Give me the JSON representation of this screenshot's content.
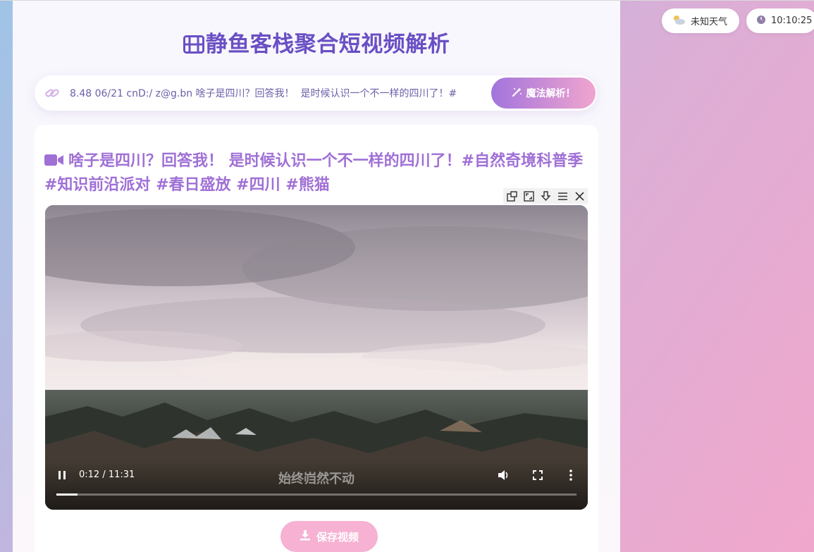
{
  "page": {
    "title": "静鱼客栈聚合短视频解析"
  },
  "search": {
    "value": "8.48 06/21 cnD:/ z@g.bn 啥子是四川？回答我！  是时候认识一个不一样的四川了！#",
    "parse_label": "魔法解析！"
  },
  "video": {
    "title": "啥子是四川？回答我！  是时候认识一个不一样的四川了！#自然奇境科普季 #知识前沿派对 #春日盛放 #四川 #熊猫",
    "time": "0:12 / 11:31",
    "subtitle": "始终岿然不动",
    "progress": 0.0174
  },
  "save": {
    "label": "保存视频"
  },
  "status": {
    "weather": "未知天气",
    "clock": "10:10:25"
  },
  "colors": {
    "title": "#6a4fc4",
    "video_title": "#a070d6",
    "accent_start": "#a274dc",
    "accent_end": "#f0a5cf",
    "save_button": "#f6b1d3"
  },
  "icons": {
    "title": "film-icon",
    "search": "link-icon",
    "parse": "magic-wand-icon",
    "video_title": "video-camera-icon",
    "toolbar": [
      "picture-in-picture-icon",
      "fullscreen-icon",
      "download-icon",
      "menu-icon",
      "close-icon"
    ],
    "save": "download-icon",
    "weather": "partly-cloudy-icon",
    "clock": "clock-icon"
  }
}
